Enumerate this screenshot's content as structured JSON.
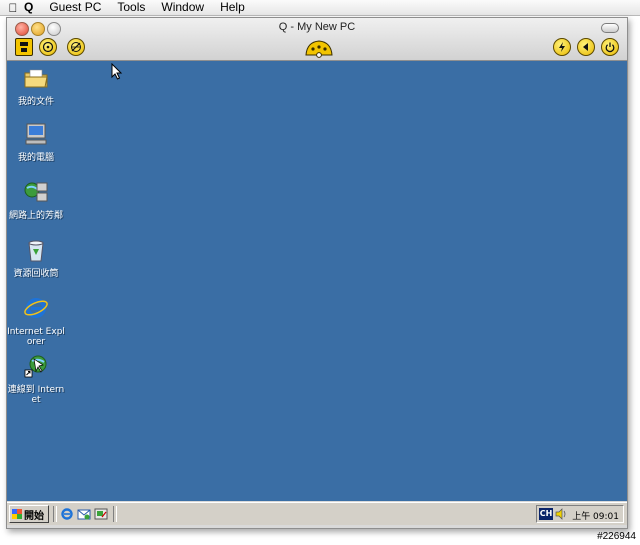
{
  "menubar": {
    "apple_icon": "apple-icon",
    "items": [
      "Q",
      "Guest PC",
      "Tools",
      "Window",
      "Help"
    ]
  },
  "window": {
    "title": "Q - My New PC"
  },
  "desktop": {
    "background": "#3a6ea5",
    "icons": [
      {
        "label": "我的文件",
        "icon": "folder-icon"
      },
      {
        "label": "我的電腦",
        "icon": "computer-icon"
      },
      {
        "label": "網路上的芳鄰",
        "icon": "network-icon"
      },
      {
        "label": "資源回收筒",
        "icon": "recycle-bin-icon"
      },
      {
        "label": "Internet Explorer",
        "icon": "internet-explorer-icon"
      },
      {
        "label": "連線到 Internet",
        "icon": "connect-internet-icon"
      }
    ]
  },
  "taskbar": {
    "start_label": "開始",
    "ime": "CH",
    "clock": "上午 09:01"
  },
  "footer": {
    "id": "#226944"
  }
}
